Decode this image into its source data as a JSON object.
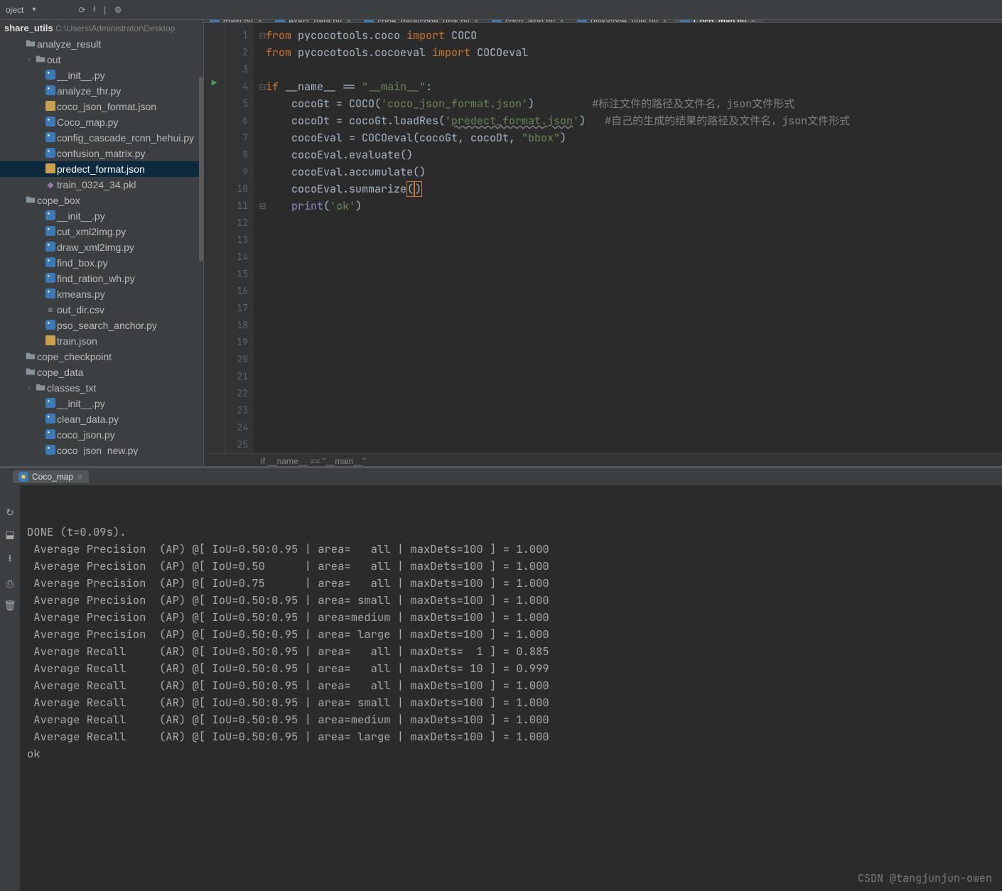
{
  "toolbar": {
    "project_label": "oject",
    "icons": [
      "sync-icon",
      "download-icon",
      "divide-icon",
      "gear-icon"
    ]
  },
  "sidebar": {
    "root_label": "share_utils",
    "root_path": "C:\\Users\\Administrator\\Desktop",
    "tree": [
      {
        "indent": 1,
        "arrow": "",
        "icon": "folder",
        "label": "analyze_result"
      },
      {
        "indent": 2,
        "arrow": "›",
        "icon": "folder",
        "label": "out"
      },
      {
        "indent": 3,
        "arrow": "",
        "icon": "py",
        "label": "__init__.py"
      },
      {
        "indent": 3,
        "arrow": "",
        "icon": "py",
        "label": "analyze_thr.py"
      },
      {
        "indent": 3,
        "arrow": "",
        "icon": "json",
        "label": "coco_json_format.json"
      },
      {
        "indent": 3,
        "arrow": "",
        "icon": "py",
        "label": "Coco_map.py"
      },
      {
        "indent": 3,
        "arrow": "",
        "icon": "py",
        "label": "config_cascade_rcnn_hehui.py"
      },
      {
        "indent": 3,
        "arrow": "",
        "icon": "py",
        "label": "confusion_matrix.py"
      },
      {
        "indent": 3,
        "arrow": "",
        "icon": "json",
        "label": "predect_format.json",
        "selected": true
      },
      {
        "indent": 3,
        "arrow": "",
        "icon": "pkl",
        "label": "train_0324_34.pkl"
      },
      {
        "indent": 1,
        "arrow": "",
        "icon": "folder",
        "label": "cope_box"
      },
      {
        "indent": 3,
        "arrow": "",
        "icon": "py",
        "label": "__init__.py"
      },
      {
        "indent": 3,
        "arrow": "",
        "icon": "py",
        "label": "cut_xml2img.py"
      },
      {
        "indent": 3,
        "arrow": "",
        "icon": "py",
        "label": "draw_xml2img.py"
      },
      {
        "indent": 3,
        "arrow": "",
        "icon": "py",
        "label": "find_box.py"
      },
      {
        "indent": 3,
        "arrow": "",
        "icon": "py",
        "label": "find_ration_wh.py"
      },
      {
        "indent": 3,
        "arrow": "",
        "icon": "py",
        "label": "kmeans.py"
      },
      {
        "indent": 3,
        "arrow": "",
        "icon": "file",
        "label": "out_dir.csv"
      },
      {
        "indent": 3,
        "arrow": "",
        "icon": "py",
        "label": "pso_search_anchor.py"
      },
      {
        "indent": 3,
        "arrow": "",
        "icon": "json",
        "label": "train.json"
      },
      {
        "indent": 1,
        "arrow": "",
        "icon": "folder",
        "label": "cope_checkpoint"
      },
      {
        "indent": 1,
        "arrow": "",
        "icon": "folder",
        "label": "cope_data"
      },
      {
        "indent": 2,
        "arrow": "›",
        "icon": "folder",
        "label": "classes_txt"
      },
      {
        "indent": 3,
        "arrow": "",
        "icon": "py",
        "label": "__init__.py"
      },
      {
        "indent": 3,
        "arrow": "",
        "icon": "py",
        "label": "clean_data.py"
      },
      {
        "indent": 3,
        "arrow": "",
        "icon": "py",
        "label": "coco_json.py"
      },
      {
        "indent": 3,
        "arrow": "",
        "icon": "py",
        "label": "coco_json_new.py"
      }
    ]
  },
  "tabs": [
    {
      "label": "main.py",
      "active": false
    },
    {
      "label": "exact_data.py",
      "active": false
    },
    {
      "label": "cope_data\\cope_utils.py",
      "active": false
    },
    {
      "label": "coco_json.py",
      "active": false
    },
    {
      "label": "utils\\cope_utils.py",
      "active": false
    },
    {
      "label": "Coco_map.py",
      "active": true
    }
  ],
  "editor": {
    "line_count": 25,
    "code_tokens": [
      [
        {
          "t": "from ",
          "c": "kw"
        },
        {
          "t": "pycocotools.coco ",
          "c": "id"
        },
        {
          "t": "import ",
          "c": "kw"
        },
        {
          "t": "COCO",
          "c": "id"
        }
      ],
      [
        {
          "t": "from ",
          "c": "kw"
        },
        {
          "t": "pycocotools.cocoeval ",
          "c": "id"
        },
        {
          "t": "import ",
          "c": "kw"
        },
        {
          "t": "COCOeval",
          "c": "id"
        }
      ],
      [],
      [
        {
          "t": "if ",
          "c": "kw"
        },
        {
          "t": "__name__ == ",
          "c": "id"
        },
        {
          "t": "\"__main__\"",
          "c": "str"
        },
        {
          "t": ":",
          "c": "id"
        }
      ],
      [
        {
          "t": "    cocoGt = COCO(",
          "c": "id"
        },
        {
          "t": "'coco_json_format.json'",
          "c": "str"
        },
        {
          "t": ")         ",
          "c": "id"
        },
        {
          "t": "#标注文件的路径及文件名，json文件形式",
          "c": "cmt"
        }
      ],
      [
        {
          "t": "    cocoDt = cocoGt.loadRes(",
          "c": "id"
        },
        {
          "t": "'",
          "c": "str"
        },
        {
          "t": "predect_format.json",
          "c": "str underline"
        },
        {
          "t": "'",
          "c": "str"
        },
        {
          "t": ")   ",
          "c": "id"
        },
        {
          "t": "#自己的生成的结果的路径及文件名，json文件形式",
          "c": "cmt"
        }
      ],
      [
        {
          "t": "    cocoEval = COCOeval(cocoGt, cocoDt, ",
          "c": "id"
        },
        {
          "t": "\"bbox\"",
          "c": "str"
        },
        {
          "t": ")",
          "c": "id"
        }
      ],
      [
        {
          "t": "    cocoEval.evaluate()",
          "c": "id"
        }
      ],
      [
        {
          "t": "    cocoEval.accumulate()",
          "c": "id"
        }
      ],
      [
        {
          "t": "    cocoEval.summarize",
          "c": "id"
        },
        {
          "t": "(",
          "c": "id paren-hl"
        },
        {
          "t": ")",
          "c": "id paren-hl"
        }
      ],
      [
        {
          "t": "    ",
          "c": "id"
        },
        {
          "t": "print",
          "c": "builtin"
        },
        {
          "t": "(",
          "c": "id"
        },
        {
          "t": "'ok'",
          "c": "str"
        },
        {
          "t": ")",
          "c": "id"
        }
      ]
    ],
    "fold_markers": {
      "1": "⊟",
      "2": "",
      "4": "⊟",
      "11": "⊟_end"
    }
  },
  "breadcrumb": "if __name__ == \"__main__\"",
  "run": {
    "tab_label": "Coco_map",
    "lines": [
      "DONE (t=0.09s).",
      " Average Precision  (AP) @[ IoU=0.50:0.95 | area=   all | maxDets=100 ] = 1.000",
      " Average Precision  (AP) @[ IoU=0.50      | area=   all | maxDets=100 ] = 1.000",
      " Average Precision  (AP) @[ IoU=0.75      | area=   all | maxDets=100 ] = 1.000",
      " Average Precision  (AP) @[ IoU=0.50:0.95 | area= small | maxDets=100 ] = 1.000",
      " Average Precision  (AP) @[ IoU=0.50:0.95 | area=medium | maxDets=100 ] = 1.000",
      " Average Precision  (AP) @[ IoU=0.50:0.95 | area= large | maxDets=100 ] = 1.000",
      " Average Recall     (AR) @[ IoU=0.50:0.95 | area=   all | maxDets=  1 ] = 0.885",
      " Average Recall     (AR) @[ IoU=0.50:0.95 | area=   all | maxDets= 10 ] = 0.999",
      " Average Recall     (AR) @[ IoU=0.50:0.95 | area=   all | maxDets=100 ] = 1.000",
      " Average Recall     (AR) @[ IoU=0.50:0.95 | area= small | maxDets=100 ] = 1.000",
      " Average Recall     (AR) @[ IoU=0.50:0.95 | area=medium | maxDets=100 ] = 1.000",
      " Average Recall     (AR) @[ IoU=0.50:0.95 | area= large | maxDets=100 ] = 1.000",
      "ok"
    ]
  },
  "watermark": "CSDN @tangjunjun-owen"
}
